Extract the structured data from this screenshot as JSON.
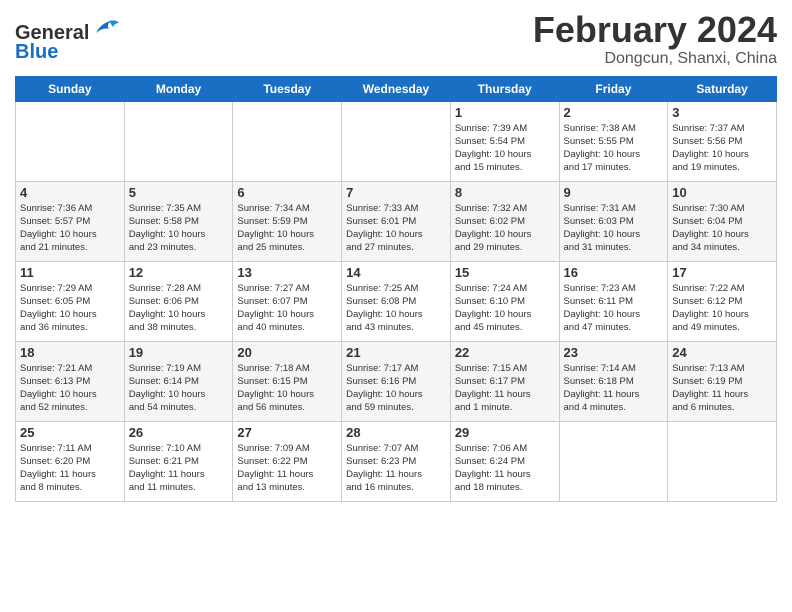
{
  "header": {
    "logo_general": "General",
    "logo_blue": "Blue",
    "month_title": "February 2024",
    "location": "Dongcun, Shanxi, China"
  },
  "days_of_week": [
    "Sunday",
    "Monday",
    "Tuesday",
    "Wednesday",
    "Thursday",
    "Friday",
    "Saturday"
  ],
  "weeks": [
    [
      {
        "day": "",
        "info": ""
      },
      {
        "day": "",
        "info": ""
      },
      {
        "day": "",
        "info": ""
      },
      {
        "day": "",
        "info": ""
      },
      {
        "day": "1",
        "info": "Sunrise: 7:39 AM\nSunset: 5:54 PM\nDaylight: 10 hours\nand 15 minutes."
      },
      {
        "day": "2",
        "info": "Sunrise: 7:38 AM\nSunset: 5:55 PM\nDaylight: 10 hours\nand 17 minutes."
      },
      {
        "day": "3",
        "info": "Sunrise: 7:37 AM\nSunset: 5:56 PM\nDaylight: 10 hours\nand 19 minutes."
      }
    ],
    [
      {
        "day": "4",
        "info": "Sunrise: 7:36 AM\nSunset: 5:57 PM\nDaylight: 10 hours\nand 21 minutes."
      },
      {
        "day": "5",
        "info": "Sunrise: 7:35 AM\nSunset: 5:58 PM\nDaylight: 10 hours\nand 23 minutes."
      },
      {
        "day": "6",
        "info": "Sunrise: 7:34 AM\nSunset: 5:59 PM\nDaylight: 10 hours\nand 25 minutes."
      },
      {
        "day": "7",
        "info": "Sunrise: 7:33 AM\nSunset: 6:01 PM\nDaylight: 10 hours\nand 27 minutes."
      },
      {
        "day": "8",
        "info": "Sunrise: 7:32 AM\nSunset: 6:02 PM\nDaylight: 10 hours\nand 29 minutes."
      },
      {
        "day": "9",
        "info": "Sunrise: 7:31 AM\nSunset: 6:03 PM\nDaylight: 10 hours\nand 31 minutes."
      },
      {
        "day": "10",
        "info": "Sunrise: 7:30 AM\nSunset: 6:04 PM\nDaylight: 10 hours\nand 34 minutes."
      }
    ],
    [
      {
        "day": "11",
        "info": "Sunrise: 7:29 AM\nSunset: 6:05 PM\nDaylight: 10 hours\nand 36 minutes."
      },
      {
        "day": "12",
        "info": "Sunrise: 7:28 AM\nSunset: 6:06 PM\nDaylight: 10 hours\nand 38 minutes."
      },
      {
        "day": "13",
        "info": "Sunrise: 7:27 AM\nSunset: 6:07 PM\nDaylight: 10 hours\nand 40 minutes."
      },
      {
        "day": "14",
        "info": "Sunrise: 7:25 AM\nSunset: 6:08 PM\nDaylight: 10 hours\nand 43 minutes."
      },
      {
        "day": "15",
        "info": "Sunrise: 7:24 AM\nSunset: 6:10 PM\nDaylight: 10 hours\nand 45 minutes."
      },
      {
        "day": "16",
        "info": "Sunrise: 7:23 AM\nSunset: 6:11 PM\nDaylight: 10 hours\nand 47 minutes."
      },
      {
        "day": "17",
        "info": "Sunrise: 7:22 AM\nSunset: 6:12 PM\nDaylight: 10 hours\nand 49 minutes."
      }
    ],
    [
      {
        "day": "18",
        "info": "Sunrise: 7:21 AM\nSunset: 6:13 PM\nDaylight: 10 hours\nand 52 minutes."
      },
      {
        "day": "19",
        "info": "Sunrise: 7:19 AM\nSunset: 6:14 PM\nDaylight: 10 hours\nand 54 minutes."
      },
      {
        "day": "20",
        "info": "Sunrise: 7:18 AM\nSunset: 6:15 PM\nDaylight: 10 hours\nand 56 minutes."
      },
      {
        "day": "21",
        "info": "Sunrise: 7:17 AM\nSunset: 6:16 PM\nDaylight: 10 hours\nand 59 minutes."
      },
      {
        "day": "22",
        "info": "Sunrise: 7:15 AM\nSunset: 6:17 PM\nDaylight: 11 hours\nand 1 minute."
      },
      {
        "day": "23",
        "info": "Sunrise: 7:14 AM\nSunset: 6:18 PM\nDaylight: 11 hours\nand 4 minutes."
      },
      {
        "day": "24",
        "info": "Sunrise: 7:13 AM\nSunset: 6:19 PM\nDaylight: 11 hours\nand 6 minutes."
      }
    ],
    [
      {
        "day": "25",
        "info": "Sunrise: 7:11 AM\nSunset: 6:20 PM\nDaylight: 11 hours\nand 8 minutes."
      },
      {
        "day": "26",
        "info": "Sunrise: 7:10 AM\nSunset: 6:21 PM\nDaylight: 11 hours\nand 11 minutes."
      },
      {
        "day": "27",
        "info": "Sunrise: 7:09 AM\nSunset: 6:22 PM\nDaylight: 11 hours\nand 13 minutes."
      },
      {
        "day": "28",
        "info": "Sunrise: 7:07 AM\nSunset: 6:23 PM\nDaylight: 11 hours\nand 16 minutes."
      },
      {
        "day": "29",
        "info": "Sunrise: 7:06 AM\nSunset: 6:24 PM\nDaylight: 11 hours\nand 18 minutes."
      },
      {
        "day": "",
        "info": ""
      },
      {
        "day": "",
        "info": ""
      }
    ]
  ]
}
